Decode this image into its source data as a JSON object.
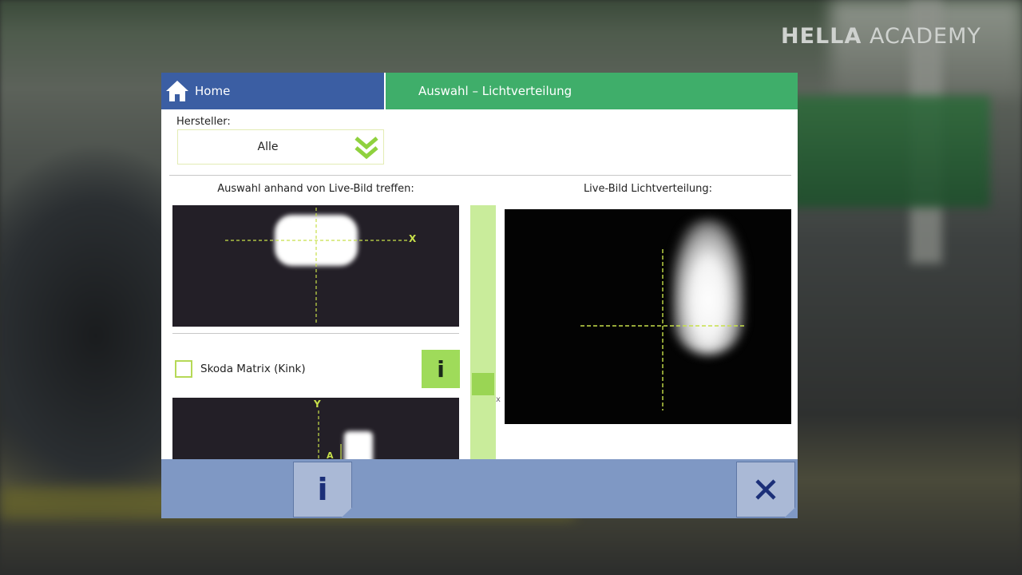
{
  "brand": {
    "bold": "HELLA",
    "light": "ACADEMY"
  },
  "header": {
    "home_label": "Home",
    "section_title": "Auswahl – Lichtverteilung"
  },
  "filter": {
    "label": "Hersteller:",
    "value": "Alle"
  },
  "selection": {
    "heading": "Auswahl anhand von Live-Bild treffen:",
    "preview_x_label": "X",
    "preview_y_label": "Y",
    "preview_a_label": "A",
    "options": [
      {
        "label": "Skoda Matrix (Kink)",
        "checked": false
      }
    ],
    "info_glyph": "i"
  },
  "live": {
    "heading": "Live-Bild Lichtverteilung:",
    "slider_axis_label": "x",
    "slider_level": 0.67
  },
  "footer": {
    "info_glyph": "i",
    "close_glyph": "close-icon"
  },
  "colors": {
    "home_blue": "#3b5ea3",
    "header_green": "#3fae6a",
    "accent_lime": "#9fdb5a",
    "footer_blue": "#7f98c4",
    "icon_navy": "#1b2f78"
  }
}
